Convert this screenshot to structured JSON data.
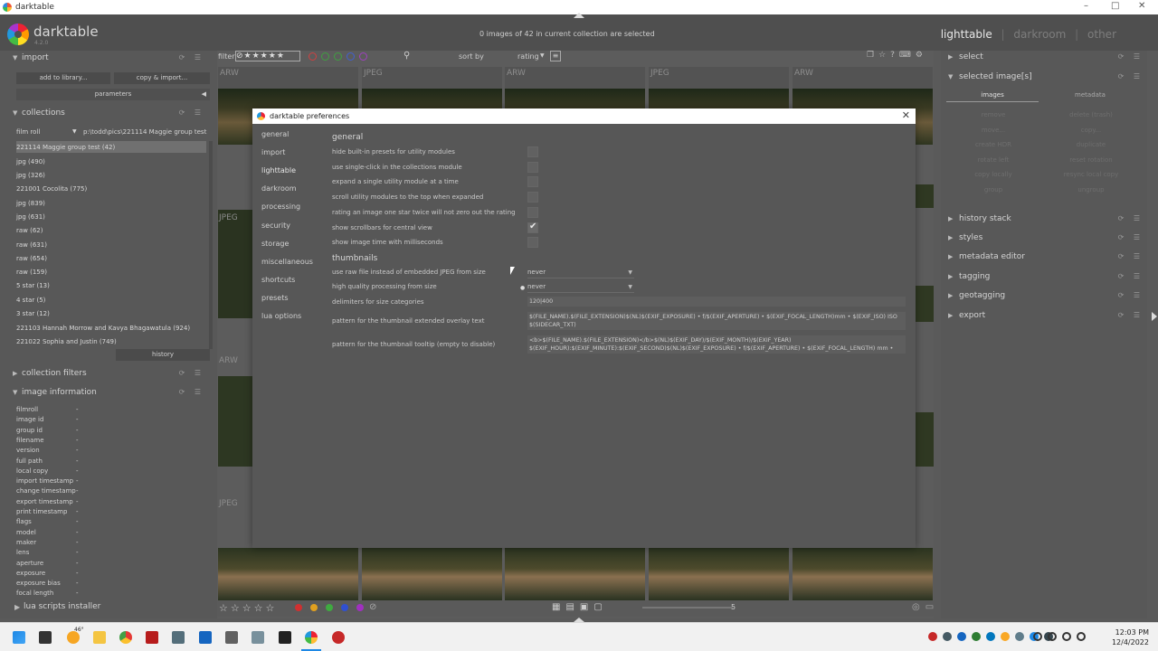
{
  "os_window": {
    "title": "darktable",
    "minimize": "–",
    "maximize": "□",
    "close": "✕"
  },
  "header": {
    "app_name": "darktable",
    "version": "4.2.0",
    "selection_status": "0 images of 42 in current collection are selected",
    "views": [
      "lighttable",
      "darkroom",
      "other"
    ],
    "active_view": "lighttable",
    "separator": "|"
  },
  "left_panel": {
    "import": {
      "title": "import",
      "add_to_library": "add to library...",
      "copy_import": "copy & import...",
      "parameters": "parameters"
    },
    "collections": {
      "title": "collections",
      "property": "film roll",
      "path": "p:\\todd\\pics\\221114 Maggie group test",
      "items": [
        "221114 Maggie group test (42)",
        "jpg (490)",
        "jpg (326)",
        "221001 Cocolita (775)",
        "jpg (839)",
        "jpg (631)",
        "raw (62)",
        "raw (631)",
        "raw (654)",
        "raw (159)",
        "5 star (13)",
        "4 star (5)",
        "3 star (12)",
        "221103 Hannah Morrow and Kavya Bhagawatula (924)",
        "221022 Sophia and Justin (749)"
      ],
      "history": "history"
    },
    "collection_filters": {
      "title": "collection filters"
    },
    "image_information": {
      "title": "image information",
      "fields": [
        "filmroll",
        "image id",
        "group id",
        "filename",
        "version",
        "full path",
        "local copy",
        "import timestamp",
        "change timestamp",
        "export timestamp",
        "print timestamp",
        "flags",
        "model",
        "maker",
        "lens",
        "aperture",
        "exposure",
        "exposure bias",
        "focal length"
      ],
      "empty_value": "-"
    },
    "lua_scripts": {
      "title": "lua scripts installer"
    }
  },
  "filterbar": {
    "filter_label": "filter",
    "sort_label": "sort by",
    "sort_value": "rating",
    "color_labels": [
      "#d04040",
      "#3fa040",
      "#3fa040",
      "#4060d0",
      "#a040c0"
    ]
  },
  "thumbs": {
    "row1": [
      "ARW",
      "JPEG",
      "ARW",
      "JPEG",
      "ARW"
    ],
    "left_labels": [
      "JPEG",
      "ARW",
      "JPEG"
    ]
  },
  "right_panel": {
    "sections": [
      "select",
      "selected image[s]",
      "history stack",
      "styles",
      "metadata editor",
      "tagging",
      "geotagging",
      "export"
    ],
    "tabs": [
      "images",
      "metadata"
    ],
    "buttons": [
      [
        "remove",
        "delete (trash)"
      ],
      [
        "move...",
        "copy..."
      ],
      [
        "create HDR",
        "duplicate"
      ],
      [
        "rotate left",
        "reset rotation"
      ],
      [
        "copy locally",
        "resync local copy"
      ],
      [
        "group",
        "ungroup"
      ]
    ]
  },
  "bottom_bar": {
    "page": "5"
  },
  "prefs": {
    "title": "darktable preferences",
    "close": "✕",
    "tabs": [
      "general",
      "import",
      "lighttable",
      "darkroom",
      "processing",
      "security",
      "storage",
      "miscellaneous",
      "shortcuts",
      "presets",
      "lua options"
    ],
    "active_tab": "lighttable",
    "general_group": "general",
    "general_rows": [
      {
        "label": "hide built-in presets for utility modules",
        "checked": false
      },
      {
        "label": "use single-click in the collections module",
        "checked": false
      },
      {
        "label": "expand a single utility module at a time",
        "checked": false
      },
      {
        "label": "scroll utility modules to the top when expanded",
        "checked": false
      },
      {
        "label": "rating an image one star twice will not zero out the rating",
        "checked": false
      },
      {
        "label": "show scrollbars for central view",
        "checked": true
      },
      {
        "label": "show image time with milliseconds",
        "checked": false
      }
    ],
    "thumbnails_group": "thumbnails",
    "use_raw": {
      "label": "use raw file instead of embedded JPEG from size",
      "value": "never"
    },
    "high_quality": {
      "label": "high quality processing from size",
      "value": "never"
    },
    "delimiters": {
      "label": "delimiters for size categories",
      "value": "120|400"
    },
    "overlay_pattern": {
      "label": "pattern for the thumbnail extended overlay text",
      "value": "$(FILE_NAME).$(FILE_EXTENSION)$(NL)$(EXIF_EXPOSURE) • f/$(EXIF_APERTURE) • $(EXIF_FOCAL_LENGTH)mm • $(EXIF_ISO) ISO $(SIDECAR_TXT)"
    },
    "tooltip_pattern": {
      "label": "pattern for the thumbnail tooltip (empty to disable)",
      "value": "<b>$(FILE_NAME).$(FILE_EXTENSION)</b>$(NL)$(EXIF_DAY)/$(EXIF_MONTH)/$(EXIF_YEAR) $(EXIF_HOUR):$(EXIF_MINUTE):$(EXIF_SECOND)$(NL)$(EXIF_EXPOSURE) • f/$(EXIF_APERTURE) • $(EXIF_FOCAL_LENGTH) mm • $(EXIF_ISO) ISO"
    }
  },
  "taskbar": {
    "time": "12:03 PM",
    "date": "12/4/2022",
    "weather": "46°"
  }
}
